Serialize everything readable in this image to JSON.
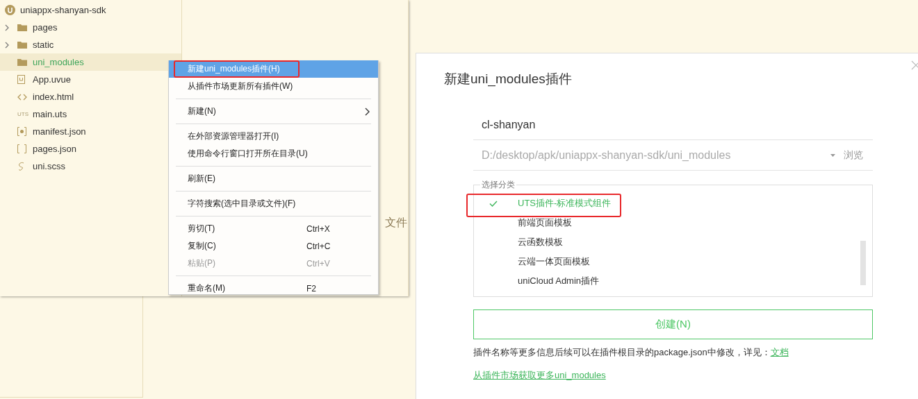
{
  "explorer": {
    "project": "uniappx-shanyan-sdk",
    "items": [
      {
        "label": "pages",
        "kind": "folder",
        "expanded": false,
        "selected": false
      },
      {
        "label": "static",
        "kind": "folder",
        "expanded": false,
        "selected": false
      },
      {
        "label": "uni_modules",
        "kind": "folder",
        "selected": true
      },
      {
        "label": "App.uvue",
        "kind": "uvue",
        "selected": false
      },
      {
        "label": "index.html",
        "kind": "html",
        "selected": false
      },
      {
        "label": "main.uts",
        "kind": "uts",
        "icon_text": "UTS",
        "selected": false
      },
      {
        "label": "manifest.json",
        "kind": "manifest",
        "selected": false
      },
      {
        "label": "pages.json",
        "kind": "json",
        "selected": false
      },
      {
        "label": "uni.scss",
        "kind": "scss",
        "selected": false
      }
    ]
  },
  "editor_fragments": [
    "文件"
  ],
  "context_menu": [
    {
      "kind": "item",
      "label": "新建uni_modules插件(H)",
      "selected": true,
      "annotated": true
    },
    {
      "kind": "item",
      "label": "从插件市场更新所有插件(W)",
      "selected": false
    },
    {
      "kind": "separator"
    },
    {
      "kind": "item",
      "label": "新建(N)",
      "selected": false,
      "submenu": true
    },
    {
      "kind": "separator"
    },
    {
      "kind": "item",
      "label": "在外部资源管理器打开(I)",
      "selected": false
    },
    {
      "kind": "item",
      "label": "使用命令行窗口打开所在目录(U)",
      "selected": false
    },
    {
      "kind": "separator"
    },
    {
      "kind": "item",
      "label": "刷新(E)",
      "selected": false
    },
    {
      "kind": "separator"
    },
    {
      "kind": "item",
      "label": "字符搜索(选中目录或文件)(F)",
      "selected": false
    },
    {
      "kind": "separator"
    },
    {
      "kind": "item",
      "label": "剪切(T)",
      "shortcut": "Ctrl+X",
      "selected": false
    },
    {
      "kind": "item",
      "label": "复制(C)",
      "shortcut": "Ctrl+C",
      "selected": false
    },
    {
      "kind": "item",
      "label": "粘贴(P)",
      "shortcut": "Ctrl+V",
      "selected": false,
      "disabled": true
    },
    {
      "kind": "separator"
    },
    {
      "kind": "item",
      "label": "重命名(M)",
      "shortcut": "F2",
      "selected": false
    }
  ],
  "dialog": {
    "title": "新建uni_modules插件",
    "name_field": {
      "value": "cl-shanyan"
    },
    "path_field": {
      "value": "D:/desktop/apk/uniappx-shanyan-sdk/uni_modules",
      "disabled": true
    },
    "browse_button": "浏览",
    "category_group": {
      "legend": "选择分类",
      "items": [
        {
          "label": "UTS插件-标准模式组件",
          "selected": true,
          "annotated": true
        },
        {
          "label": "前端页面模板",
          "selected": false
        },
        {
          "label": "云函数模板",
          "selected": false
        },
        {
          "label": "云端一体页面模板",
          "selected": false
        },
        {
          "label": "uniCloud Admin插件",
          "selected": false
        }
      ]
    },
    "create_button": "创建(N)",
    "note": "插件名称等更多信息后续可以在插件根目录的package.json中修改，详见：",
    "note_link": "文档",
    "market_link": "从插件市场获取更多uni_modules"
  }
}
